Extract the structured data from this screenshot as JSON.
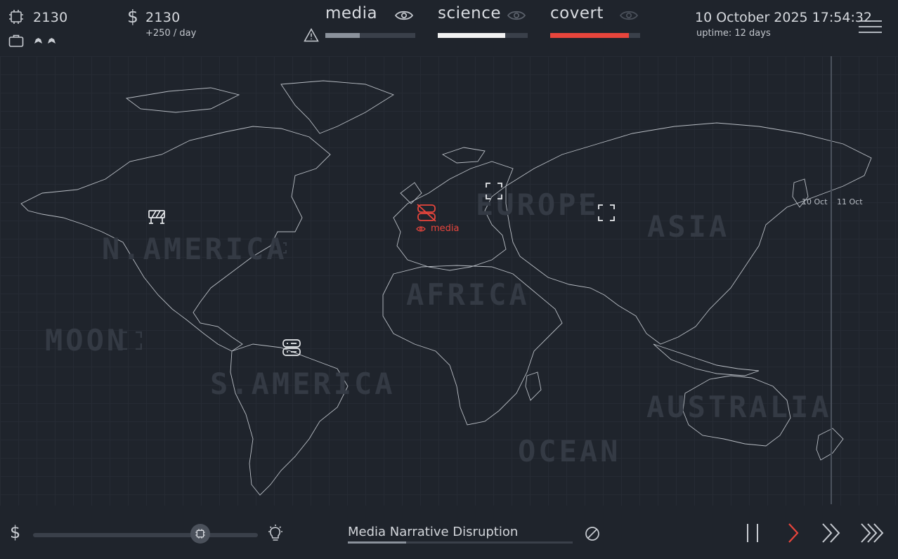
{
  "resources": {
    "compute": "2130",
    "money": "2130",
    "income": "+250 / day"
  },
  "meters": [
    {
      "label": "media",
      "fill": 0.38,
      "color": "#8b929c"
    },
    {
      "label": "science",
      "fill": 0.75,
      "color": "#f2f2f2"
    },
    {
      "label": "covert",
      "fill": 0.875,
      "color": "#e8453c"
    }
  ],
  "clock": {
    "datetime": "10 October 2025 17:54:32",
    "uptime": "uptime: 12 days"
  },
  "map": {
    "regions": [
      "N.AMERICA",
      "EUROPE",
      "ASIA",
      "AFRICA",
      "S.AMERICA",
      "AUSTRALIA",
      "OCEAN",
      "MOON"
    ],
    "selected_node_label": "media",
    "timeline_ticks": [
      "10 Oct",
      "11 Oct"
    ]
  },
  "bottom": {
    "research_title": "Media Narrative Disruption",
    "research_progress": 0.26,
    "allocation_slider": 0.745
  },
  "colors": {
    "accent_red": "#e8453c",
    "background": "#1f242c",
    "region_text": "#343a44"
  }
}
